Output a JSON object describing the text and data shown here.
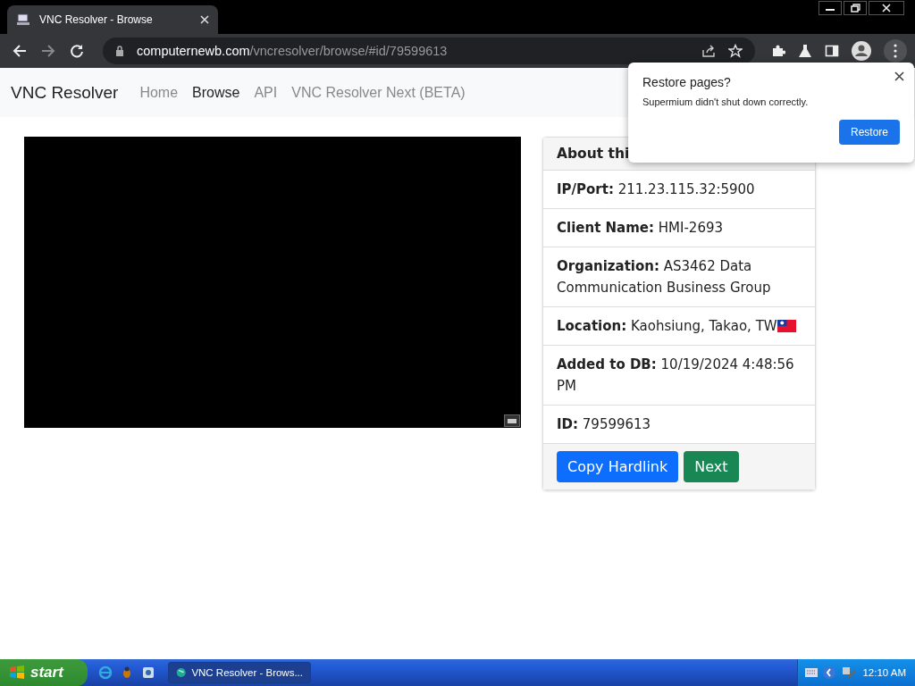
{
  "browser": {
    "tabs": [
      {
        "title": "VNC Resolver - Browse",
        "selected": true
      }
    ],
    "address": {
      "host": "computernewb.com",
      "path": "/vncresolver/browse/#id/79599613"
    }
  },
  "navbar": {
    "brand": "VNC Resolver",
    "links": [
      {
        "label": "Home",
        "selected": false
      },
      {
        "label": "Browse",
        "selected": true
      },
      {
        "label": "API",
        "selected": false
      },
      {
        "label": "VNC Resolver Next (BETA)",
        "selected": false
      }
    ]
  },
  "card": {
    "header": "About thi",
    "rows": [
      {
        "text": "**IP/Port:** 211.23.115.32:5900"
      },
      {
        "text": "**Client Name:** HMI-2693"
      },
      {
        "text": "**Organization:** AS3462 Data Communication Business Group"
      },
      {
        "text": "**Location:** Kaohsiung, Takao, TW",
        "flag": true
      },
      {
        "text": "**Added to DB:** 10/19/2024 4:48:56 PM"
      },
      {
        "text": "**ID:** 79599613"
      }
    ],
    "buttons": [
      {
        "label": "Copy Hardlink",
        "kind": "primary"
      },
      {
        "label": "Next",
        "kind": "success"
      }
    ]
  },
  "popup": {
    "title": "Restore pages?",
    "message": "Supermium didn't shut down correctly.",
    "button": "Restore"
  },
  "taskbar": {
    "start": "start",
    "tasks": [
      {
        "label": "VNC Resolver - Brows...",
        "selected": true
      }
    ],
    "clock": "12:10 AM"
  }
}
